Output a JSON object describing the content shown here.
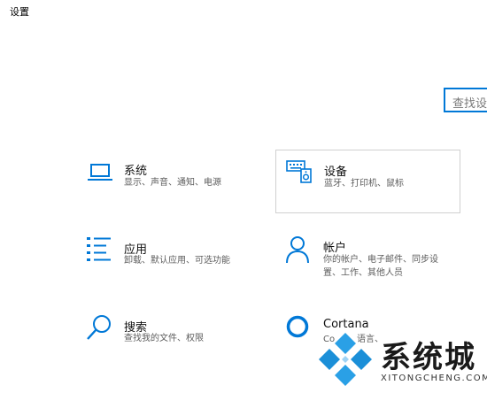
{
  "window": {
    "title": "设置"
  },
  "search": {
    "placeholder": "查找设置"
  },
  "tiles": [
    {
      "id": "system",
      "title": "系统",
      "lines": [
        "显示、声音、通知、电源"
      ],
      "icon": "laptop-icon"
    },
    {
      "id": "devices",
      "title": "设备",
      "lines": [
        "蓝牙、打印机、鼠标"
      ],
      "icon": "keyboard-speaker-icon"
    },
    {
      "id": "apps",
      "title": "应用",
      "lines": [
        "卸载、默认应用、可选功能"
      ],
      "icon": "app-list-icon"
    },
    {
      "id": "accounts",
      "title": "帐户",
      "lines": [
        "你的帐户、电子邮件、同步设",
        "置、工作、其他人员"
      ],
      "icon": "person-icon"
    },
    {
      "id": "search",
      "title": "搜索",
      "lines": [
        "查找我的文件、权限"
      ],
      "icon": "magnifier-icon"
    },
    {
      "id": "cortana",
      "title": "Cortana",
      "lines": [
        "Co",
        "语言、"
      ],
      "icon": "cortana-ring-icon"
    }
  ],
  "watermark": {
    "text": "系统城",
    "url": "XITONGCHENG.COM"
  },
  "colors": {
    "accent": "#0078d7",
    "watermark_blue": "#1b8fd8"
  }
}
